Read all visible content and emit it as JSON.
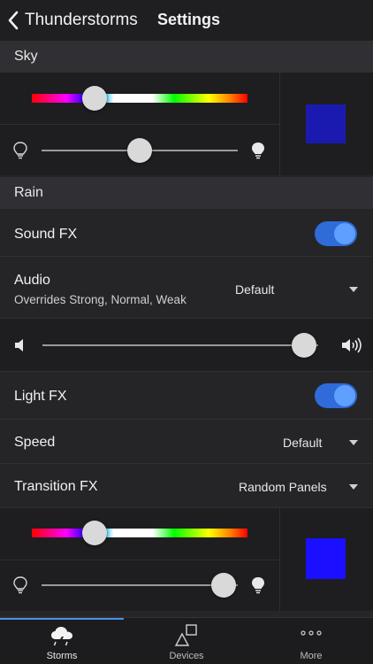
{
  "nav": {
    "back_label": "Thunderstorms",
    "title": "Settings"
  },
  "sections": {
    "sky": "Sky",
    "rain": "Rain"
  },
  "sky": {
    "hue": 0.29,
    "brightness": 0.5,
    "swatch_color": "#1a1ab0"
  },
  "rain": {
    "sound_fx": {
      "label": "Sound FX",
      "on": true
    },
    "audio": {
      "label": "Audio",
      "sub": "Overrides Strong, Normal, Weak",
      "value": "Default"
    },
    "volume": 0.95,
    "light_fx": {
      "label": "Light FX",
      "on": true
    },
    "speed": {
      "label": "Speed",
      "value": "Default"
    },
    "transition_fx": {
      "label": "Transition FX",
      "value": "Random Panels"
    },
    "hue": 0.29,
    "brightness": 0.93,
    "swatch_color": "#1a10ff"
  },
  "tabs": [
    {
      "label": "Storms",
      "icon": "storm-cloud-icon",
      "active": true
    },
    {
      "label": "Devices",
      "icon": "devices-icon",
      "active": false
    },
    {
      "label": "More",
      "icon": "more-dots-icon",
      "active": false
    }
  ],
  "colors": {
    "accent": "#4a90e2",
    "toggle_track": "#2f6bd9",
    "toggle_knob": "#5fa0ff"
  }
}
